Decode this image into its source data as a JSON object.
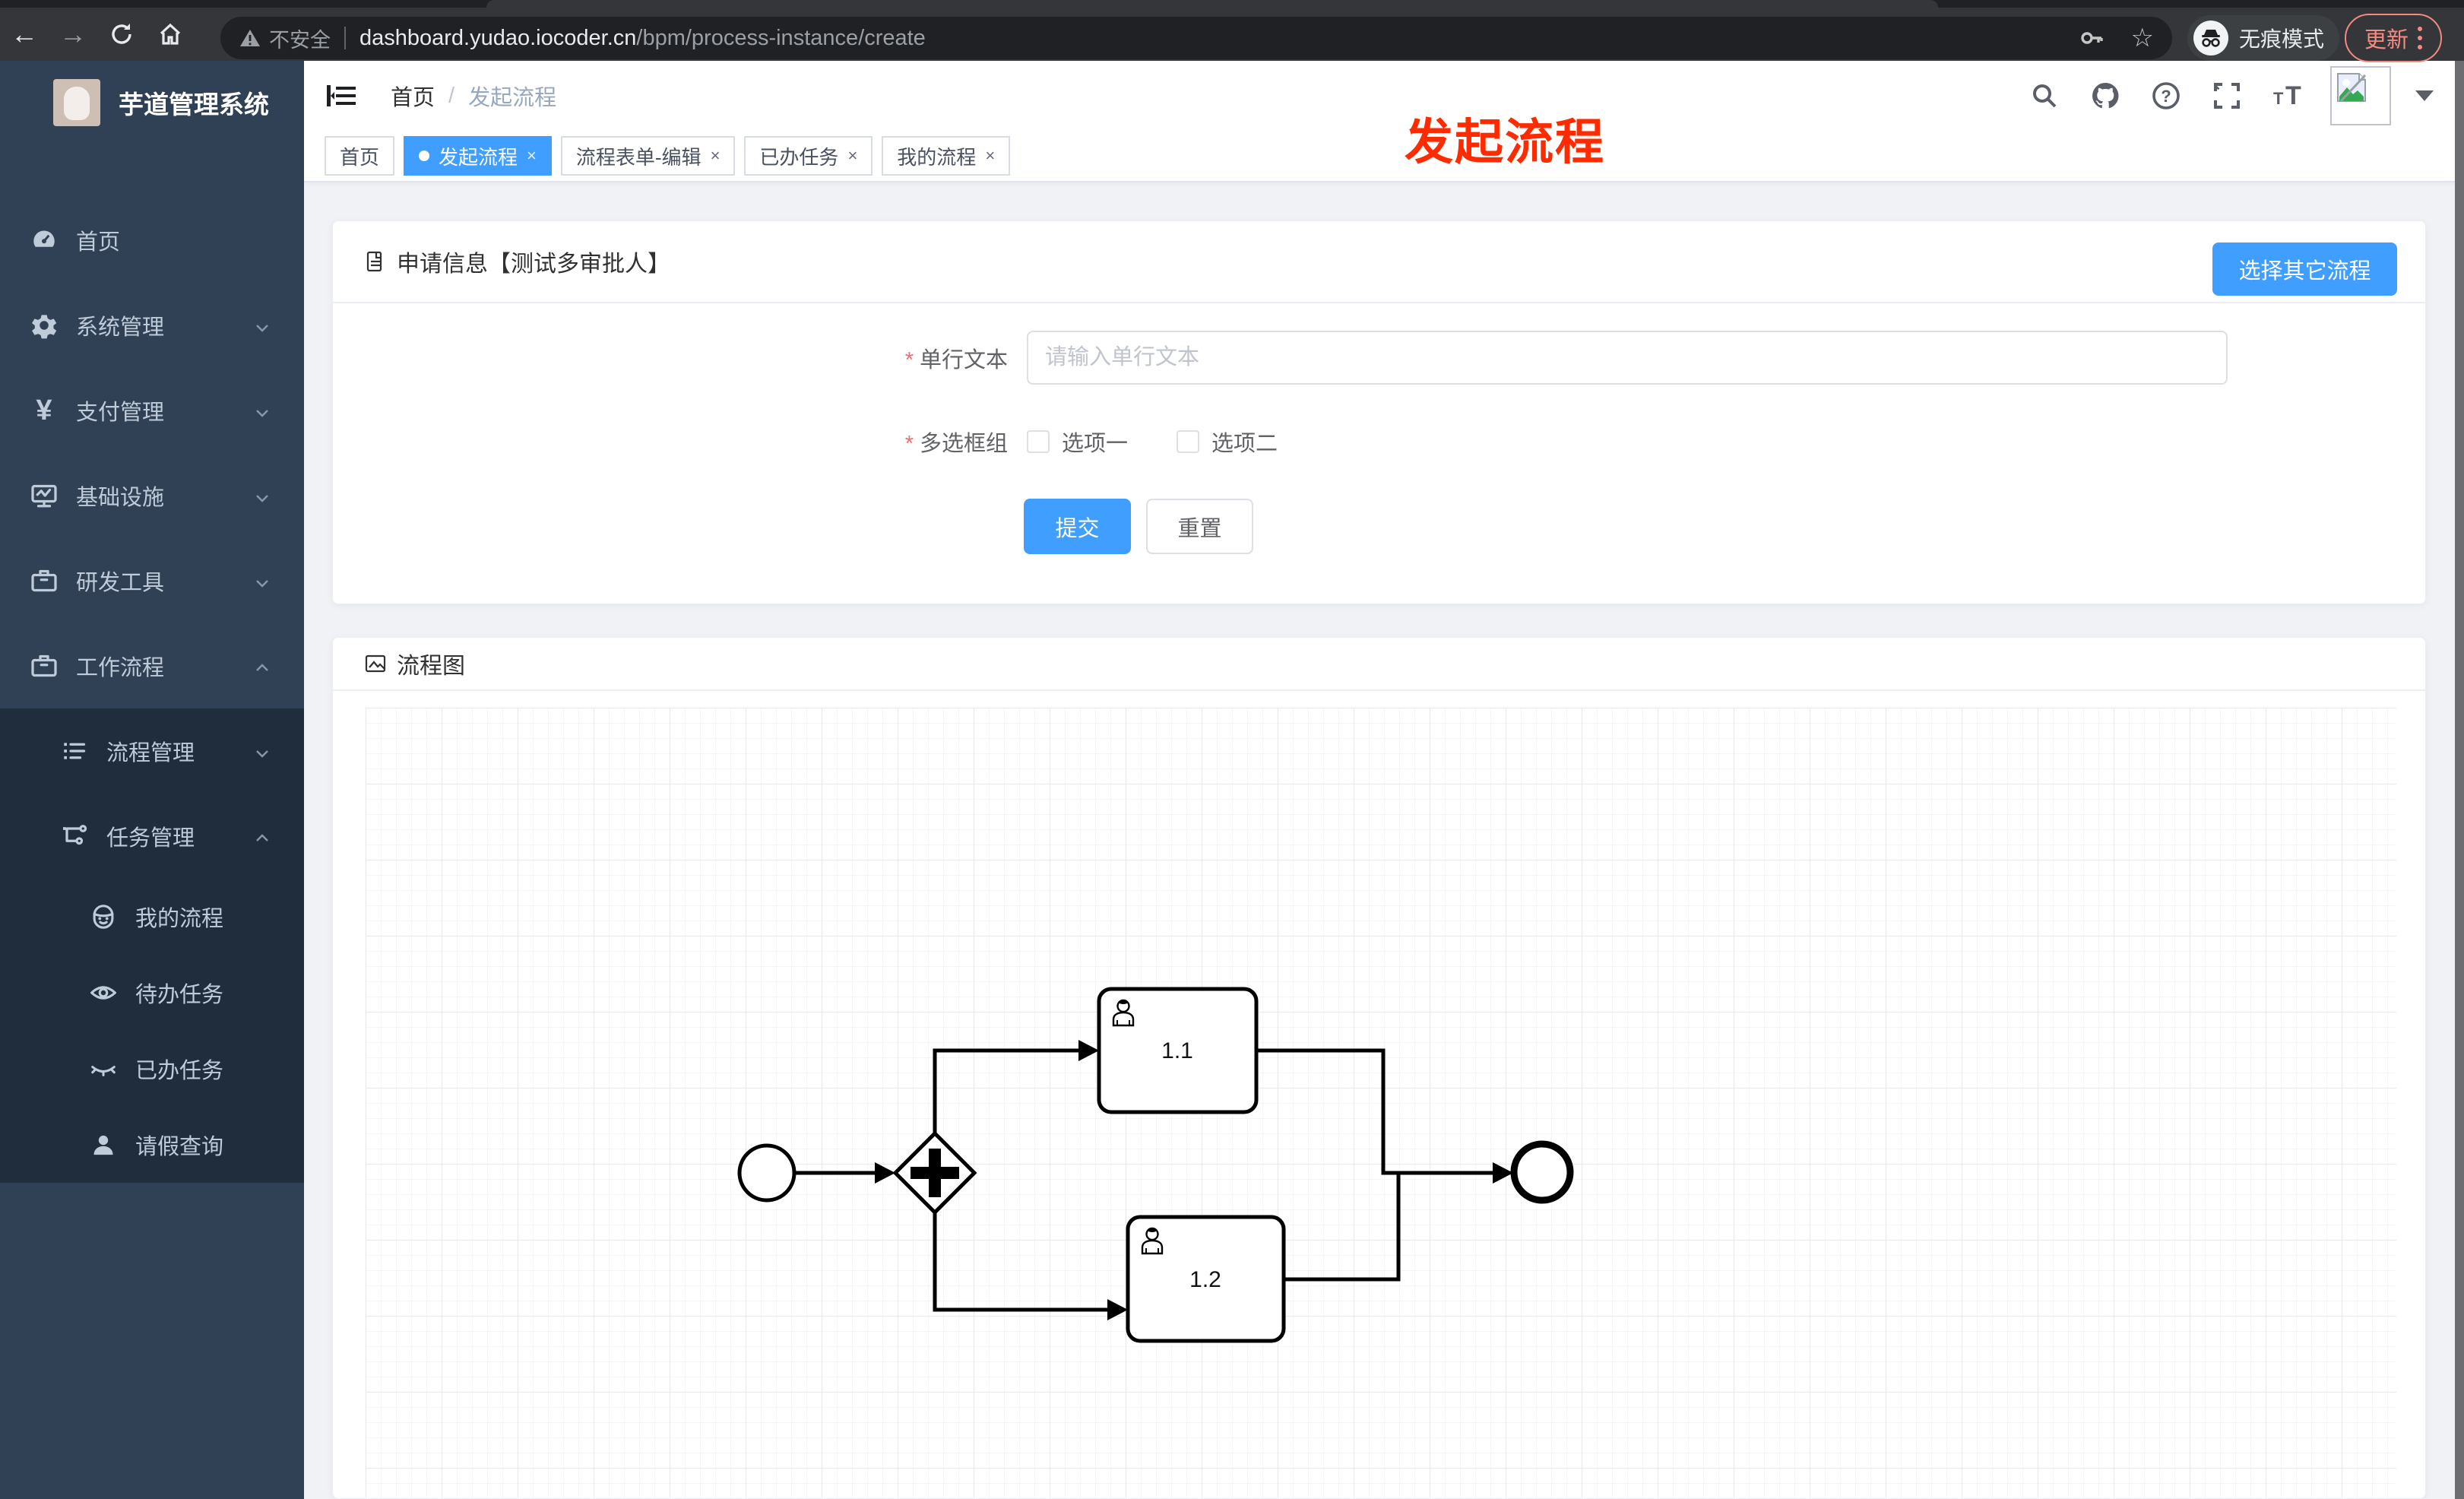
{
  "browser": {
    "security_label": "不安全",
    "url_host": "dashboard.yudao.iocoder.cn",
    "url_path": "/bpm/process-instance/create",
    "incognito_label": "无痕模式",
    "update_label": "更新"
  },
  "sidebar": {
    "title": "芋道管理系统",
    "items": [
      {
        "label": "首页",
        "icon": "dashboard-icon",
        "level": 1
      },
      {
        "label": "系统管理",
        "icon": "gear-icon",
        "level": 1,
        "chevron": "down"
      },
      {
        "label": "支付管理",
        "icon": "yen-icon",
        "level": 1,
        "chevron": "down"
      },
      {
        "label": "基础设施",
        "icon": "monitor-icon",
        "level": 1,
        "chevron": "down"
      },
      {
        "label": "研发工具",
        "icon": "toolbox-icon",
        "level": 1,
        "chevron": "down"
      },
      {
        "label": "工作流程",
        "icon": "toolbox-icon",
        "level": 1,
        "chevron": "up"
      },
      {
        "label": "流程管理",
        "icon": "list-tree-icon",
        "level": 2,
        "chevron": "down"
      },
      {
        "label": "任务管理",
        "icon": "flow-icon",
        "level": 2,
        "chevron": "up"
      },
      {
        "label": "我的流程",
        "icon": "face-icon",
        "level": 3
      },
      {
        "label": "待办任务",
        "icon": "eye-icon",
        "level": 3
      },
      {
        "label": "已办任务",
        "icon": "eye-off-icon",
        "level": 3
      },
      {
        "label": "请假查询",
        "icon": "user-icon",
        "level": 3
      }
    ]
  },
  "header": {
    "breadcrumb_home": "首页",
    "breadcrumb_sep": "/",
    "breadcrumb_current": "发起流程",
    "overlay_title": "发起流程"
  },
  "tags": [
    {
      "label": "首页",
      "active": false,
      "closable": false
    },
    {
      "label": "发起流程",
      "active": true,
      "closable": true,
      "close_glyph": "×"
    },
    {
      "label": "流程表单-编辑",
      "active": false,
      "closable": true,
      "close_glyph": "×"
    },
    {
      "label": "已办任务",
      "active": false,
      "closable": true,
      "close_glyph": "×"
    },
    {
      "label": "我的流程",
      "active": false,
      "closable": true,
      "close_glyph": "×"
    }
  ],
  "form_card": {
    "title": "申请信息【测试多审批人】",
    "choose_button": "选择其它流程",
    "text_field": {
      "label": "单行文本",
      "required_mark": "*",
      "placeholder": "请输入单行文本",
      "value": ""
    },
    "checkbox_group": {
      "label": "多选框组",
      "required_mark": "*",
      "options": [
        {
          "label": "选项一",
          "checked": false
        },
        {
          "label": "选项二",
          "checked": false
        }
      ]
    },
    "submit_label": "提交",
    "reset_label": "重置"
  },
  "flow_card": {
    "title": "流程图",
    "diagram": {
      "type": "bpmn",
      "nodes": [
        {
          "id": "start",
          "type": "start-event",
          "label": ""
        },
        {
          "id": "gateway",
          "type": "parallel-gateway",
          "label": ""
        },
        {
          "id": "task1",
          "type": "user-task",
          "label": "1.1"
        },
        {
          "id": "task2",
          "type": "user-task",
          "label": "1.2"
        },
        {
          "id": "end",
          "type": "end-event",
          "label": ""
        }
      ],
      "flows": [
        {
          "from": "start",
          "to": "gateway"
        },
        {
          "from": "gateway",
          "to": "task1"
        },
        {
          "from": "gateway",
          "to": "task2"
        },
        {
          "from": "task1",
          "to": "end"
        },
        {
          "from": "task2",
          "to": "end"
        }
      ]
    }
  },
  "colors": {
    "accent_blue": "#409eff",
    "overlay_red": "#ff2b00",
    "sidebar_bg": "#304156",
    "submenu_bg": "#1f2d3d",
    "update_salmon": "#f28b82",
    "required_red": "#f56c6c"
  }
}
